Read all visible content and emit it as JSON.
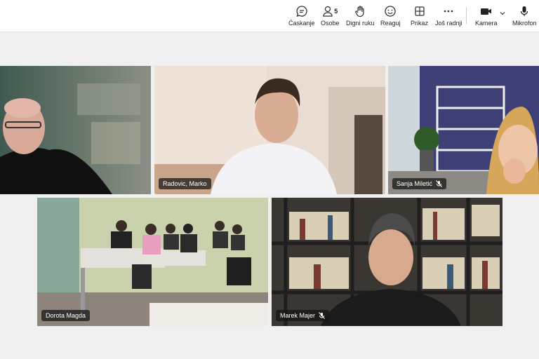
{
  "toolbar": {
    "chat": "Ćaskanje",
    "people": "Osobe",
    "people_count": "5",
    "raise_hand": "Digni ruku",
    "react": "Reaguj",
    "view": "Prikaz",
    "more": "Još radnji",
    "camera": "Kamera",
    "mic": "Mikrofon"
  },
  "participants": {
    "p1": {
      "name": "",
      "muted": false
    },
    "p2": {
      "name": "Radovic, Marko",
      "muted": false,
      "active_speaker": true
    },
    "p3": {
      "name": "Sanja Miletić",
      "muted": true
    },
    "p4": {
      "name": "Dorota Magda",
      "muted": false
    },
    "p5": {
      "name": "Marek Majer",
      "muted": true
    }
  },
  "colors": {
    "accent": "#6264a7",
    "background": "#f0f0f0"
  }
}
